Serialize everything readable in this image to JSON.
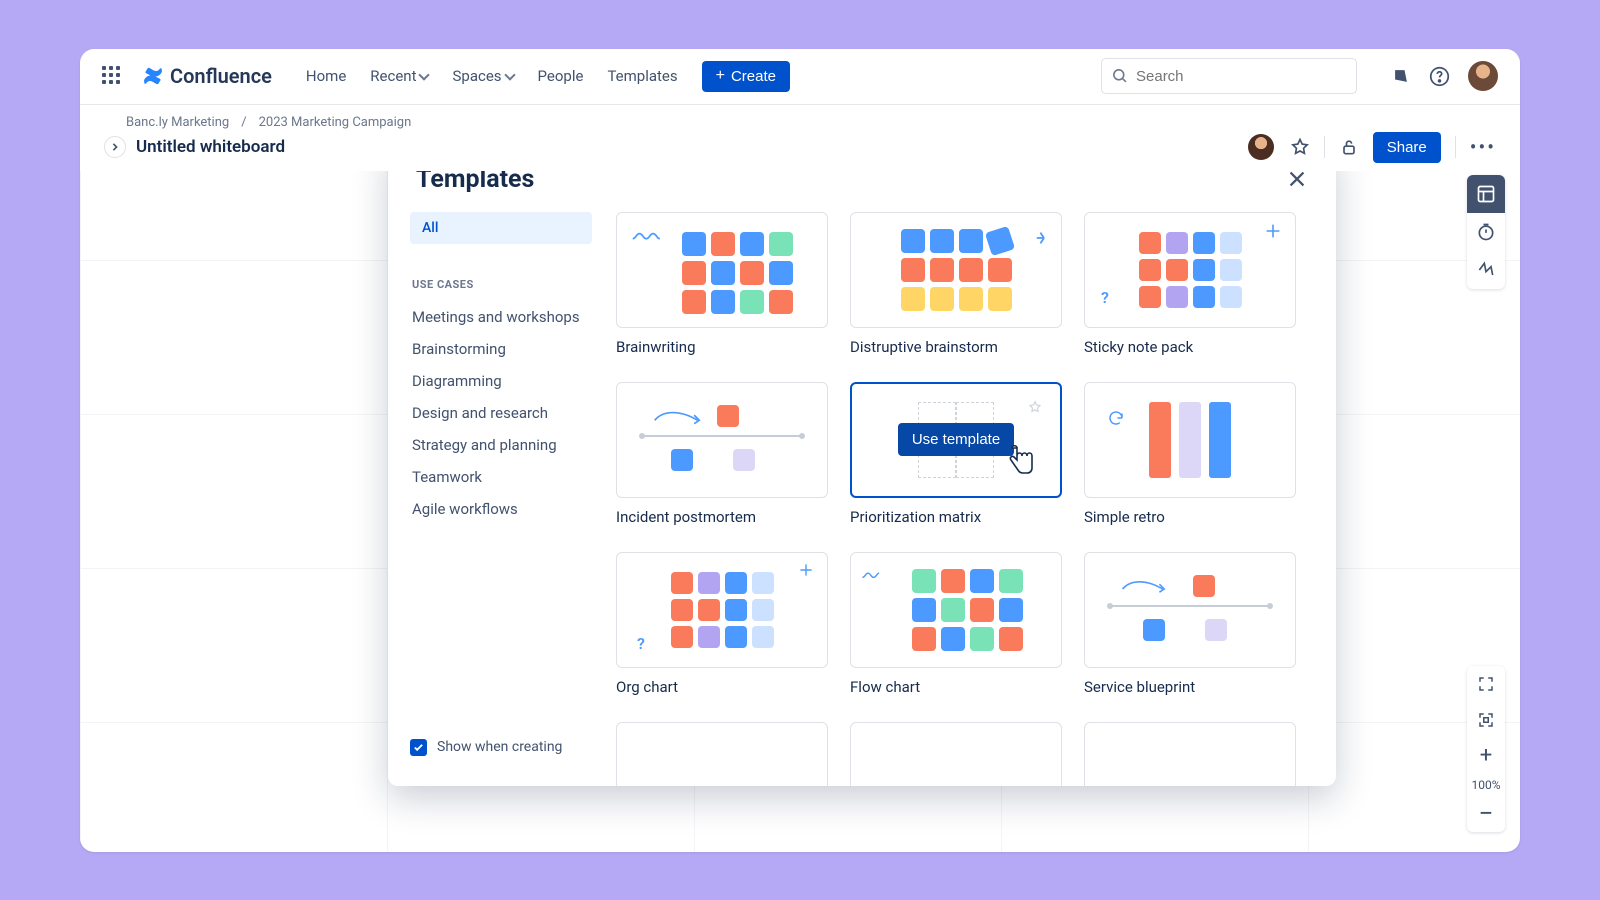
{
  "topnav": {
    "product": "Confluence",
    "links": {
      "home": "Home",
      "recent": "Recent",
      "spaces": "Spaces",
      "people": "People",
      "templates": "Templates"
    },
    "create_label": "Create",
    "search_placeholder": "Search"
  },
  "breadcrumb": {
    "space": "Banc.ly Marketing",
    "page": "2023 Marketing Campaign"
  },
  "doc": {
    "title": "Untitled whiteboard",
    "share_label": "Share"
  },
  "zoom": {
    "level": "100%"
  },
  "modal": {
    "title": "Templates",
    "all_label": "All",
    "section_label": "USE CASES",
    "categories": [
      "Meetings and workshops",
      "Brainstorming",
      "Diagramming",
      "Design and research",
      "Strategy and planning",
      "Teamwork",
      "Agile workflows"
    ],
    "show_when_creating": "Show when creating",
    "use_template_label": "Use template",
    "templates": [
      {
        "name": "Brainwriting"
      },
      {
        "name": "Distruptive brainstorm"
      },
      {
        "name": "Sticky note pack"
      },
      {
        "name": "Incident postmortem"
      },
      {
        "name": "Prioritization matrix"
      },
      {
        "name": "Simple retro"
      },
      {
        "name": "Org chart"
      },
      {
        "name": "Flow chart"
      },
      {
        "name": "Service blueprint"
      }
    ]
  }
}
